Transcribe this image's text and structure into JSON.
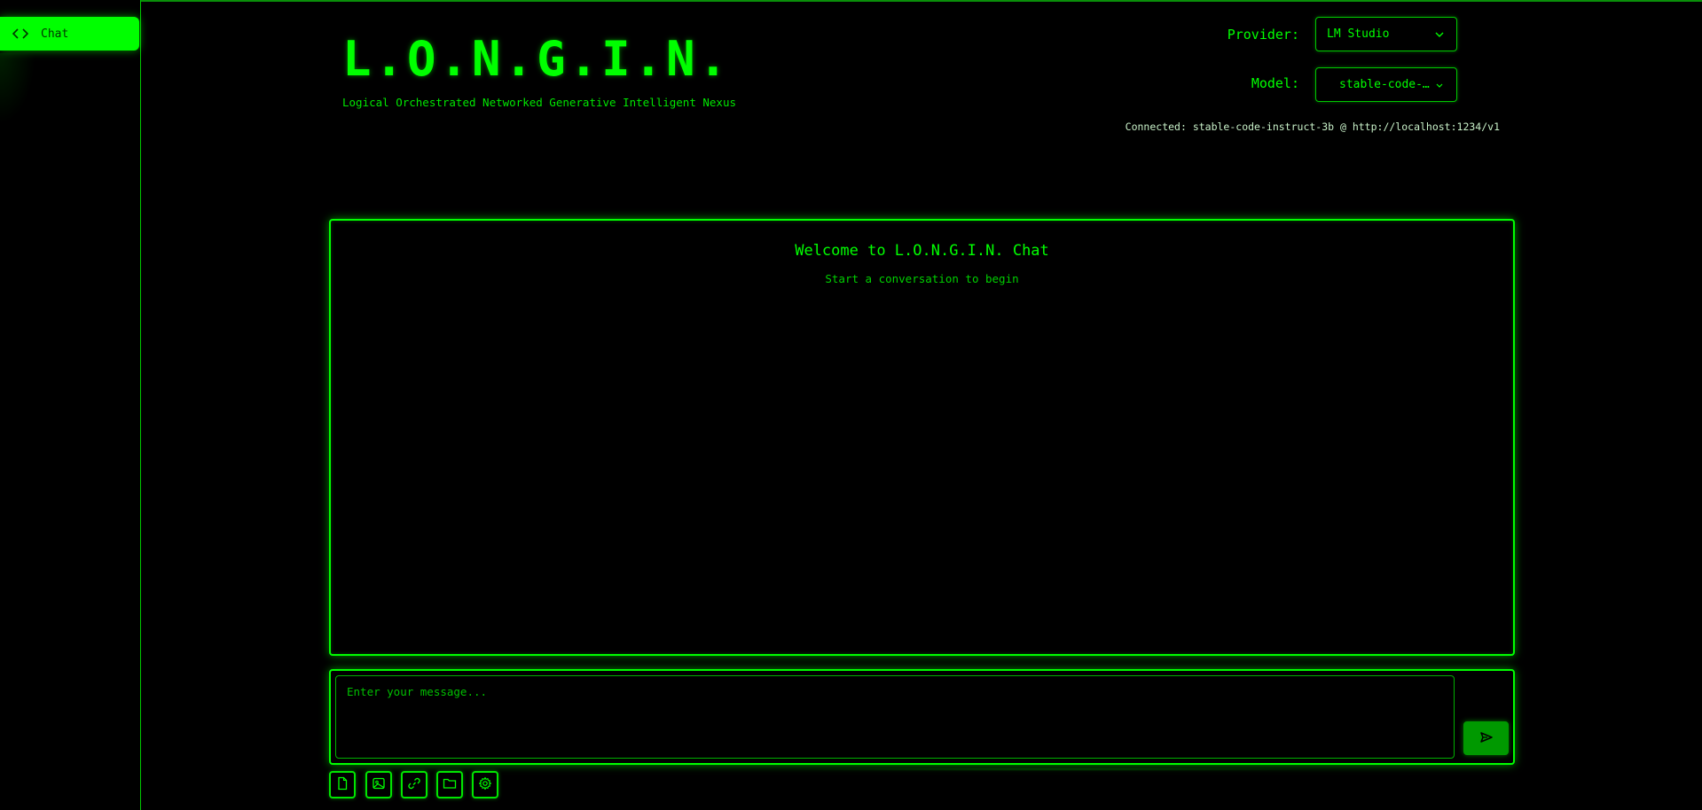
{
  "sidebar": {
    "items": [
      {
        "label": "Chat",
        "icon": "code-icon",
        "active": true
      }
    ]
  },
  "header": {
    "title": "L.O.N.G.I.N.",
    "subtitle": "Logical Orchestrated Networked Generative Intelligent Nexus"
  },
  "controls": {
    "provider_label": "Provider:",
    "provider_value": "LM Studio",
    "model_label": "Model:",
    "model_value": "stable-code-instruct-3b",
    "status": "Connected: stable-code-instruct-3b @ http://localhost:1234/v1"
  },
  "chat": {
    "welcome_title": "Welcome to L.O.N.G.I.N. Chat",
    "welcome_subtitle": "Start a conversation to begin"
  },
  "composer": {
    "placeholder": "Enter your message...",
    "send_icon": "send-icon",
    "tools": [
      "file-icon",
      "image-icon",
      "link-icon",
      "folder-icon",
      "gear-icon"
    ]
  },
  "colors": {
    "accent": "#00ff00",
    "background": "#000000",
    "send_button": "#009900",
    "status_text": "#c8f0c8"
  }
}
